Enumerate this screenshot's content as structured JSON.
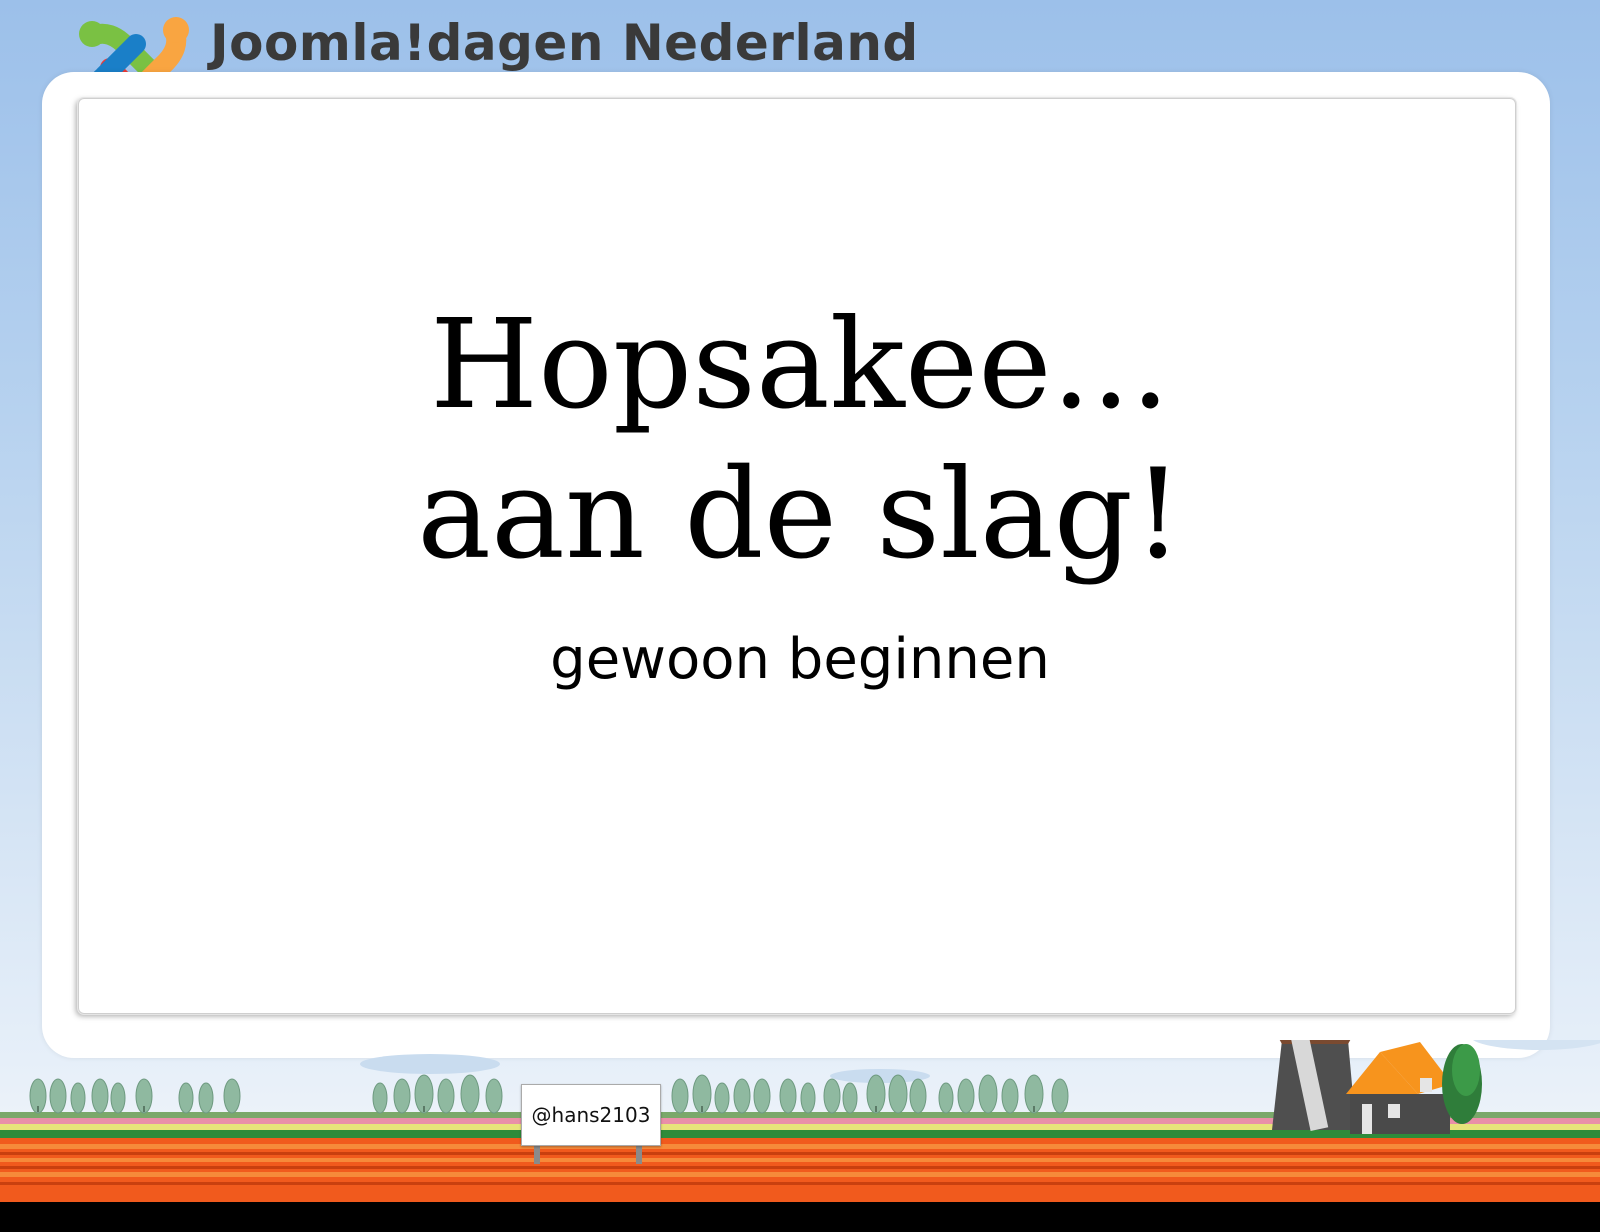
{
  "header": {
    "brand_title": "Joomla!dagen Nederland",
    "logo_icon": "joomla-logo-icon"
  },
  "slide": {
    "headline_line1": "Hopsakee...",
    "headline_line2": "aan de slag!",
    "subtitle": "gewoon beginnen"
  },
  "footer": {
    "billboard_text": "@hans2103",
    "illustration": "windmill-tulip-field"
  },
  "colors": {
    "sky": "#9cc0ea",
    "frame": "#ffffff",
    "tulips": "#f15a1d",
    "grass": "#2e8b3a",
    "text": "#000000"
  }
}
